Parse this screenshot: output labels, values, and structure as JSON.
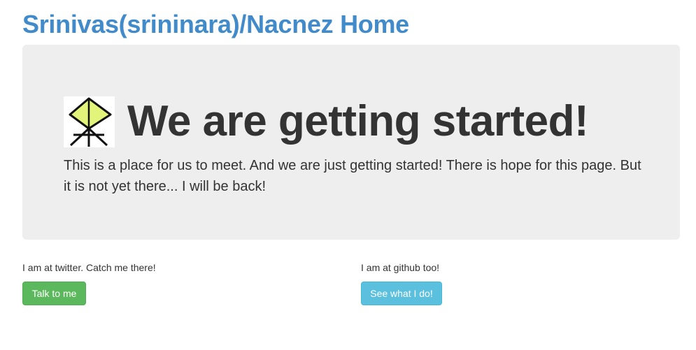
{
  "header": {
    "title": "Srinivas(srininara)/Nacnez Home"
  },
  "jumbotron": {
    "logo_icon": "kite-stick-figure-icon",
    "heading": "We are getting started!",
    "text": "This is a place for us to meet. And we are just getting started! There is hope for this page. But it is not yet there... I will be back!"
  },
  "twitter": {
    "text": "I am at twitter. Catch me there!",
    "button_label": "Talk to me"
  },
  "github": {
    "text": "I am at github too!",
    "button_label": "See what I do!"
  },
  "colors": {
    "title": "#428bca",
    "jumbotron_bg": "#eeeeee",
    "btn_success": "#5cb85c",
    "btn_info": "#5bc0de",
    "logo_fill": "#e2f57a"
  }
}
